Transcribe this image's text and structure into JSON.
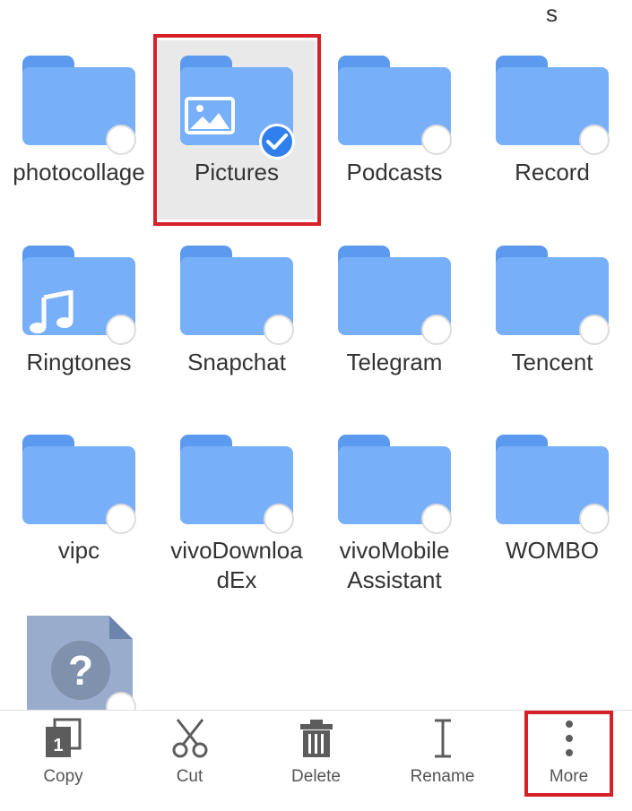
{
  "top_partial_text": "s",
  "items": [
    {
      "name": "photocollage",
      "selected": false
    },
    {
      "name": "Pictures",
      "selected": true,
      "glyph": "image-icon"
    },
    {
      "name": "Podcasts",
      "selected": false
    },
    {
      "name": "Record",
      "selected": false
    },
    {
      "name": "Ringtones",
      "selected": false,
      "glyph": "music-note-icon"
    },
    {
      "name": "Snapchat",
      "selected": false
    },
    {
      "name": "Telegram",
      "selected": false
    },
    {
      "name": "Tencent",
      "selected": false
    },
    {
      "name": "vipc",
      "selected": false
    },
    {
      "name": "vivoDownloadEx",
      "selected": false
    },
    {
      "name": "vivoMobileAssistant",
      "selected": false
    },
    {
      "name": "WOMBO",
      "selected": false
    }
  ],
  "unknown_file": {
    "icon": "unknown-file-icon",
    "glyph": "?"
  },
  "toolbar": {
    "copy": {
      "label": "Copy",
      "badge": "1",
      "icon": "copy-icon"
    },
    "cut": {
      "label": "Cut",
      "icon": "scissors-icon"
    },
    "delete": {
      "label": "Delete",
      "icon": "trash-icon"
    },
    "rename": {
      "label": "Rename",
      "icon": "text-cursor-icon"
    },
    "more": {
      "label": "More",
      "icon": "more-vertical-icon"
    }
  },
  "colors": {
    "folder": "#78aff9",
    "folder_tab": "#5c9af0",
    "highlight": "#d72128",
    "check": "#2f80ed"
  }
}
